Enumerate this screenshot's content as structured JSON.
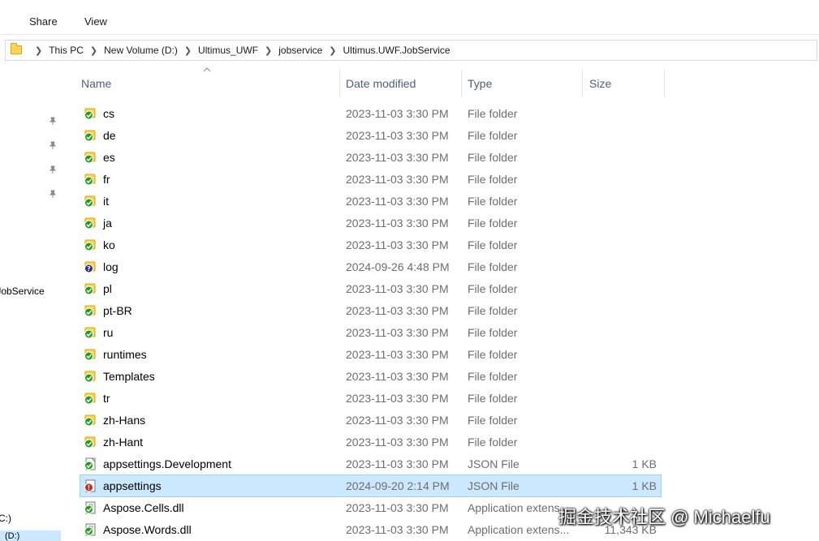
{
  "ribbon": {
    "tabs": [
      "Share",
      "View"
    ]
  },
  "address": {
    "crumbs": [
      "This PC",
      "New Volume (D:)",
      "Ultimus_UWF",
      "jobservice",
      "Ultimus.UWF.JobService"
    ]
  },
  "nav": {
    "items": [
      ".JobService",
      "C:)",
      "(D:)"
    ]
  },
  "columns": {
    "name": "Name",
    "date": "Date modified",
    "type": "Type",
    "size": "Size"
  },
  "rows": [
    {
      "name": "cs",
      "date": "2023-11-03 3:30 PM",
      "type": "File folder",
      "size": "",
      "icon": "folder-sync-ok-icon"
    },
    {
      "name": "de",
      "date": "2023-11-03 3:30 PM",
      "type": "File folder",
      "size": "",
      "icon": "folder-sync-ok-icon"
    },
    {
      "name": "es",
      "date": "2023-11-03 3:30 PM",
      "type": "File folder",
      "size": "",
      "icon": "folder-sync-ok-icon"
    },
    {
      "name": "fr",
      "date": "2023-11-03 3:30 PM",
      "type": "File folder",
      "size": "",
      "icon": "folder-sync-ok-icon"
    },
    {
      "name": "it",
      "date": "2023-11-03 3:30 PM",
      "type": "File folder",
      "size": "",
      "icon": "folder-sync-ok-icon"
    },
    {
      "name": "ja",
      "date": "2023-11-03 3:30 PM",
      "type": "File folder",
      "size": "",
      "icon": "folder-sync-ok-icon"
    },
    {
      "name": "ko",
      "date": "2023-11-03 3:30 PM",
      "type": "File folder",
      "size": "",
      "icon": "folder-sync-ok-icon"
    },
    {
      "name": "log",
      "date": "2024-09-26 4:48 PM",
      "type": "File folder",
      "size": "",
      "icon": "folder-sync-unknown-icon"
    },
    {
      "name": "pl",
      "date": "2023-11-03 3:30 PM",
      "type": "File folder",
      "size": "",
      "icon": "folder-sync-ok-icon"
    },
    {
      "name": "pt-BR",
      "date": "2023-11-03 3:30 PM",
      "type": "File folder",
      "size": "",
      "icon": "folder-sync-ok-icon"
    },
    {
      "name": "ru",
      "date": "2023-11-03 3:30 PM",
      "type": "File folder",
      "size": "",
      "icon": "folder-sync-ok-icon"
    },
    {
      "name": "runtimes",
      "date": "2023-11-03 3:30 PM",
      "type": "File folder",
      "size": "",
      "icon": "folder-sync-ok-icon"
    },
    {
      "name": "Templates",
      "date": "2023-11-03 3:30 PM",
      "type": "File folder",
      "size": "",
      "icon": "folder-sync-ok-icon"
    },
    {
      "name": "tr",
      "date": "2023-11-03 3:30 PM",
      "type": "File folder",
      "size": "",
      "icon": "folder-sync-ok-icon"
    },
    {
      "name": "zh-Hans",
      "date": "2023-11-03 3:30 PM",
      "type": "File folder",
      "size": "",
      "icon": "folder-sync-ok-icon"
    },
    {
      "name": "zh-Hant",
      "date": "2023-11-03 3:30 PM",
      "type": "File folder",
      "size": "",
      "icon": "folder-sync-ok-icon"
    },
    {
      "name": "appsettings.Development",
      "date": "2023-11-03 3:30 PM",
      "type": "JSON File",
      "size": "1 KB",
      "icon": "json-file-sync-ok-icon"
    },
    {
      "name": "appsettings",
      "date": "2024-09-20 2:14 PM",
      "type": "JSON File",
      "size": "1 KB",
      "icon": "json-file-sync-error-icon",
      "selected": true
    },
    {
      "name": "Aspose.Cells.dll",
      "date": "2023-11-03 3:30 PM",
      "type": "Application extens...",
      "size": "",
      "icon": "dll-file-sync-ok-icon"
    },
    {
      "name": "Aspose.Words.dll",
      "date": "2023-11-03 3:30 PM",
      "type": "Application extens...",
      "size": "11,343 KB",
      "icon": "dll-file-sync-ok-icon"
    }
  ],
  "watermark": "掘金技术社区 @ Michaelfu",
  "colors": {
    "selection": "#cce8ff",
    "sync_ok": "#1e9e1e",
    "sync_error": "#c42b1c",
    "sync_unknown": "#2b2b8c",
    "folder": "#ffd35a"
  }
}
